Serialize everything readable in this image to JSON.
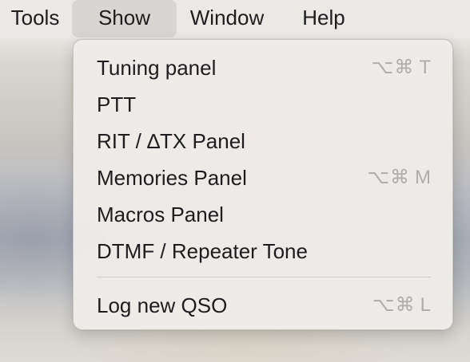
{
  "menubar": {
    "items": [
      {
        "label": "Tools"
      },
      {
        "label": "Show"
      },
      {
        "label": "Window"
      },
      {
        "label": "Help"
      }
    ]
  },
  "show_menu": {
    "items": [
      {
        "label": "Tuning panel",
        "modifiers": "⌥⌘",
        "key": "T"
      },
      {
        "label": "PTT"
      },
      {
        "label": "RIT / ∆TX Panel"
      },
      {
        "label": "Memories Panel",
        "modifiers": "⌥⌘",
        "key": "M"
      },
      {
        "label": "Macros Panel"
      },
      {
        "label": "DTMF / Repeater Tone"
      },
      {
        "label": "Log new QSO",
        "modifiers": "⌥⌘",
        "key": "L"
      }
    ]
  }
}
